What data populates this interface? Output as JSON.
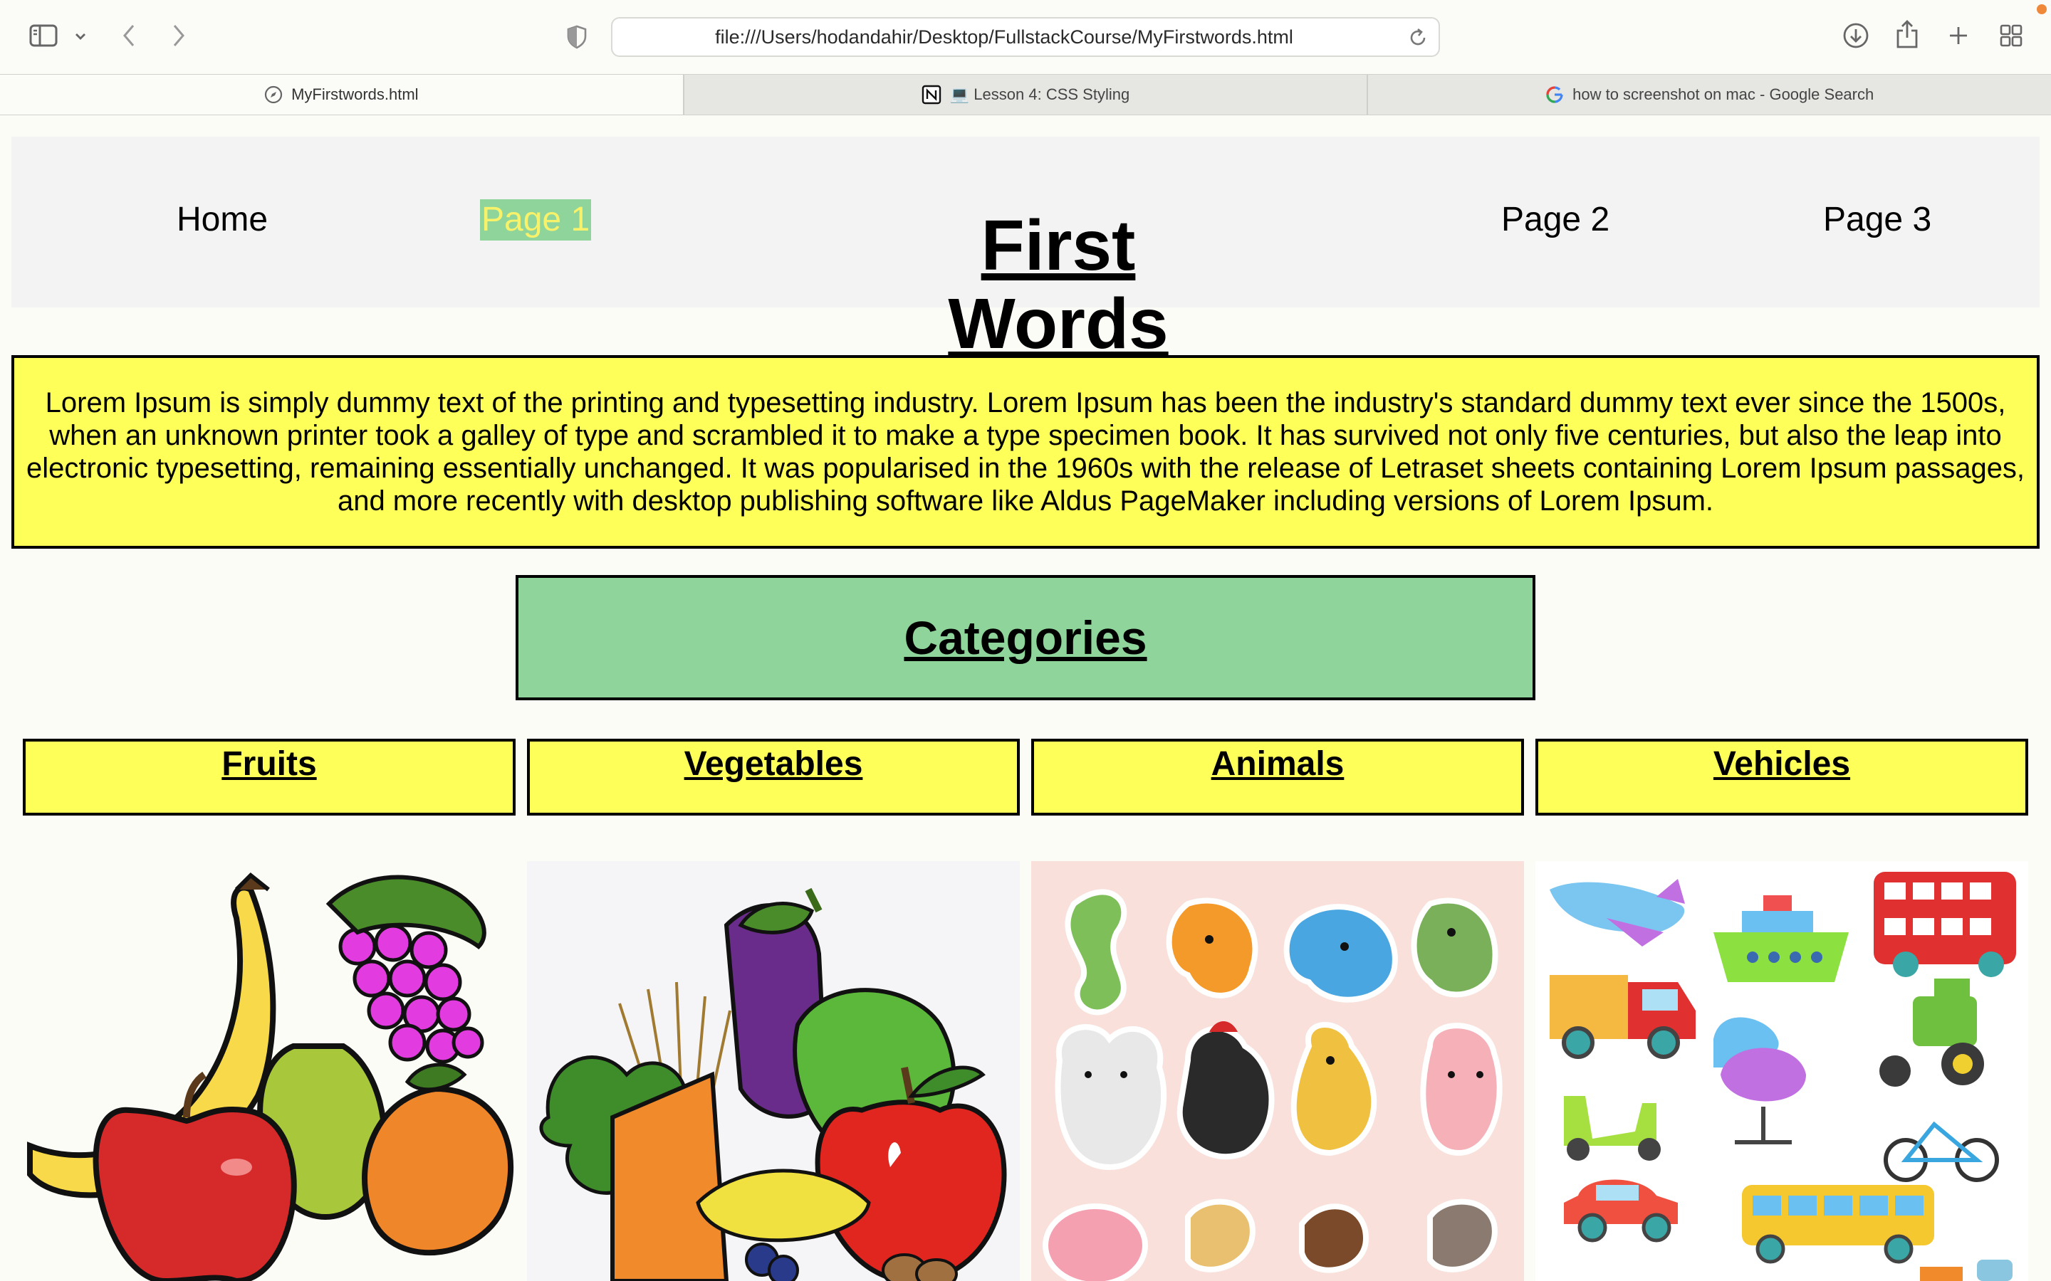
{
  "browser": {
    "url": "file:///Users/hodandahir/Desktop/FullstackCourse/MyFirstwords.html",
    "tabs": [
      {
        "label": "MyFirstwords.html",
        "icon": "compass-icon",
        "active": true
      },
      {
        "label": "💻 Lesson 4: CSS Styling",
        "icon": "notion-icon",
        "active": false
      },
      {
        "label": "how to screenshot on mac - Google Search",
        "icon": "google-icon",
        "active": false
      }
    ]
  },
  "nav": {
    "home": "Home",
    "page1": "Page 1",
    "title": "First Words",
    "page2": "Page 2",
    "page3": "Page 3"
  },
  "intro": {
    "text": "Lorem Ipsum is simply dummy text of the printing and typesetting industry. Lorem Ipsum has been the industry's standard dummy text ever since the 1500s, when an unknown printer took a galley of type and scrambled it to make a type specimen book. It has survived not only five centuries, but also the leap into electronic typesetting, remaining essentially unchanged. It was popularised in the 1960s with the release of Letraset sheets containing Lorem Ipsum passages, and more recently with desktop publishing software like Aldus PageMaker including versions of Lorem Ipsum."
  },
  "categories": {
    "heading": "Categories",
    "items": [
      {
        "label": "Fruits",
        "image": "fruits-image"
      },
      {
        "label": "Vegetables",
        "image": "vegetables-image"
      },
      {
        "label": "Animals",
        "image": "animals-image"
      },
      {
        "label": "Vehicles",
        "image": "vehicles-image"
      }
    ]
  },
  "colors": {
    "yellow": "#ffff5a",
    "green": "#8fd59b",
    "nav_bg": "#f4f3f3",
    "active_link_text": "#f8f26a"
  }
}
